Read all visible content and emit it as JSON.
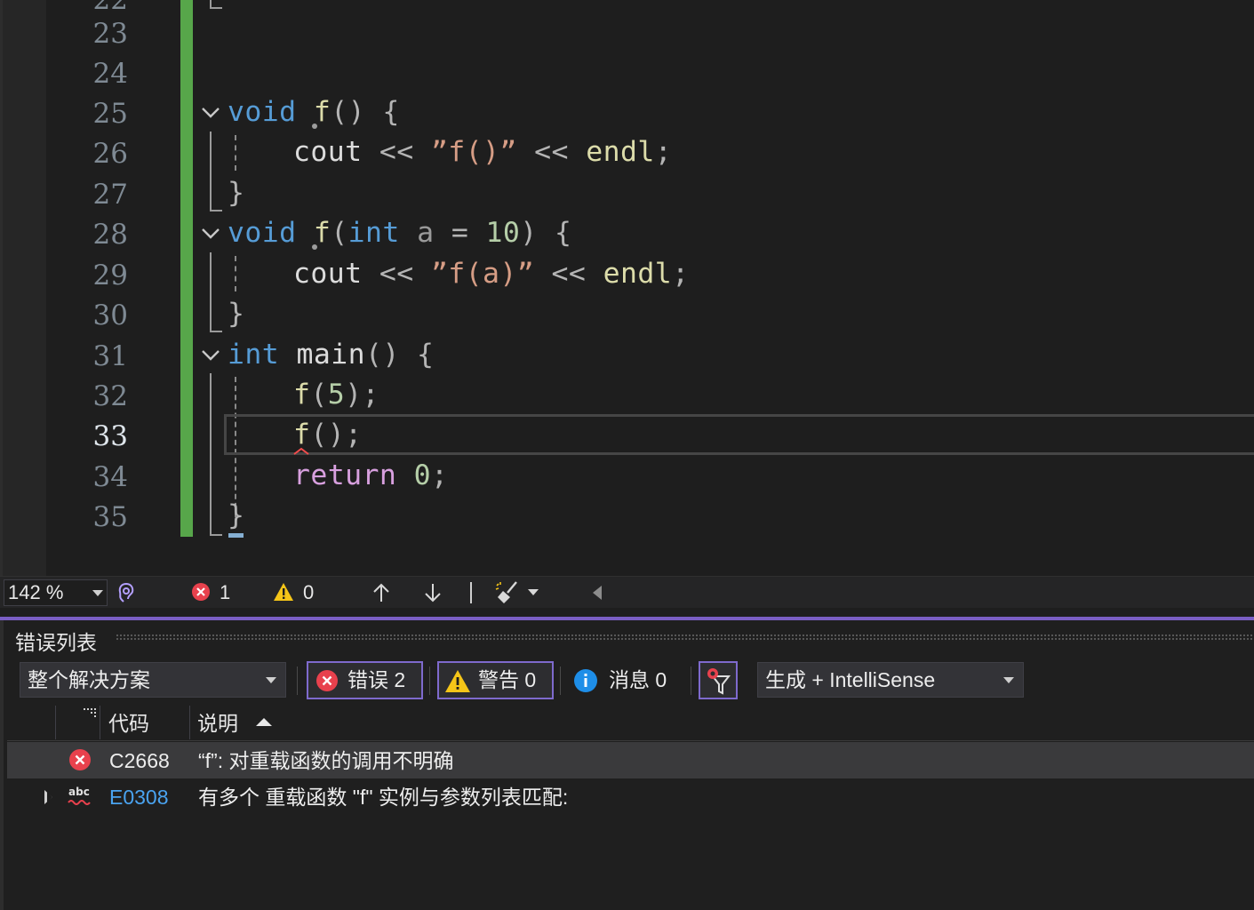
{
  "editor": {
    "line_numbers": [
      "23",
      "24",
      "25",
      "26",
      "27",
      "28",
      "29",
      "30",
      "31",
      "32",
      "33",
      "34",
      "35"
    ],
    "current_line": "33",
    "code": {
      "l25": {
        "kw": "void",
        "fn": "f",
        "rest": "() {"
      },
      "l26": {
        "a": "cout",
        "b": " << ",
        "c": "”f()”",
        "d": " << ",
        "e": "endl",
        "f": ";"
      },
      "l27": {
        "brace": "}"
      },
      "l28": {
        "kw": "void",
        "fn": "f",
        "p1": "(",
        "kw2": "int",
        "param": " a ",
        "eq": "= ",
        "num": "10",
        "rest": ") {"
      },
      "l29": {
        "a": "cout",
        "b": " << ",
        "c": "”f(a)”",
        "d": " << ",
        "e": "endl",
        "f": ";"
      },
      "l30": {
        "brace": "}"
      },
      "l31": {
        "kw": "int",
        "fn": "main",
        "rest": "() {"
      },
      "l32": {
        "fn": "f",
        "p1": "(",
        "num": "5",
        "rest": ");"
      },
      "l33": {
        "fn": "f",
        "rest": "();"
      },
      "l34": {
        "kw": "return",
        "num": "0",
        "rest": ";"
      },
      "l35": {
        "brace": "}"
      }
    },
    "colors": {
      "change_bar": "#57a64a",
      "keyword": "#569cd6",
      "function": "#dcdcaa",
      "string": "#d69d85",
      "number": "#b5cea8",
      "control": "#d8a0df"
    }
  },
  "status": {
    "zoom": "142 %",
    "errors": "1",
    "warnings": "0",
    "icons": [
      "health-icon",
      "error-icon",
      "warning-icon",
      "arrow-up-icon",
      "arrow-down-icon",
      "cleanup-brush-icon",
      "scroll-left-icon"
    ]
  },
  "error_list": {
    "title": "错误列表",
    "scope": "整个解决方案",
    "errors_label": "错误 2",
    "warnings_label": "警告 0",
    "messages_label": "消息 0",
    "build_source": "生成 + IntelliSense",
    "columns": {
      "code": "代码",
      "description": "说明"
    },
    "rows": [
      {
        "icon": "error-icon",
        "code": "C2668",
        "description": "“f”: 对重载函数的调用不明确"
      },
      {
        "icon": "intellisense-abc-icon",
        "code": "E0308",
        "description": "有多个 重载函数 \"f\" 实例与参数列表匹配:"
      }
    ],
    "accent": "#7e6acd"
  }
}
